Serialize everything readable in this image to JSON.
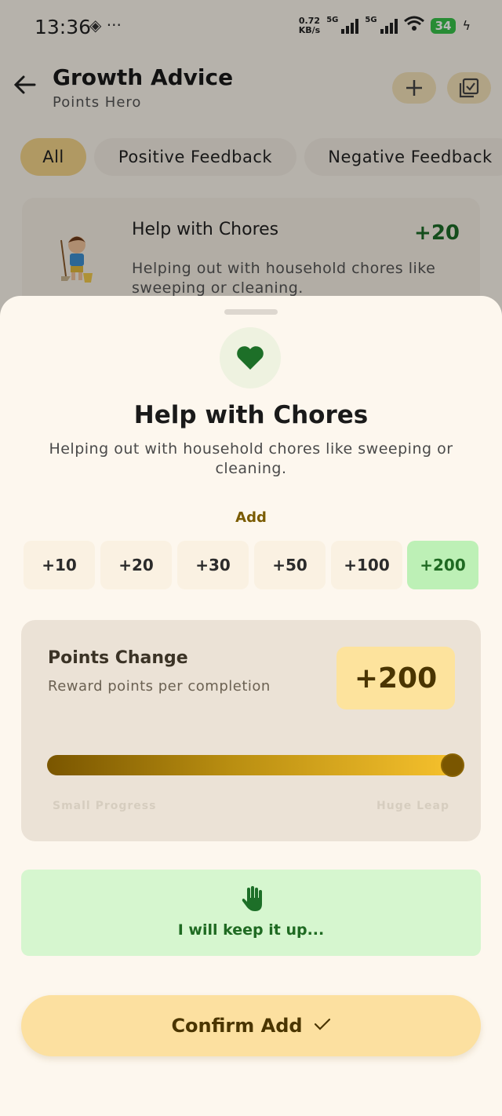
{
  "status_bar": {
    "time": "13:36",
    "extras": "◈ ···",
    "net_speed_value": "0.72",
    "net_speed_unit": "KB/s",
    "signal_tag_1": "5G",
    "signal_tag_2": "5G",
    "battery": "34"
  },
  "header": {
    "title": "Growth Advice",
    "subtitle": "Points Hero",
    "add_icon": "plus-icon",
    "check_icon": "checklist-icon"
  },
  "filters": {
    "all": "All",
    "positive": "Positive Feedback",
    "negative": "Negative Feedback"
  },
  "card": {
    "title": "Help with Chores",
    "points": "+20",
    "description": "Helping out with household chores like sweeping or cleaning."
  },
  "sheet": {
    "title": "Help with Chores",
    "description": "Helping out with household chores like sweeping or cleaning.",
    "add_label": "Add",
    "amounts": [
      "+10",
      "+20",
      "+30",
      "+50",
      "+100",
      "+200"
    ],
    "selected_amount": "+200",
    "points_title": "Points Change",
    "points_sub": "Reward points per completion",
    "points_value": "+200",
    "slider_level": 1.0,
    "slider_left": "Small Progress",
    "slider_right": "Huge Leap",
    "commit_text": "I will keep it up...",
    "confirm_label": "Confirm Add"
  },
  "colors": {
    "accent_green": "#1f6a22",
    "accent_gold": "#7a5600",
    "background": "#fdf7ee"
  }
}
